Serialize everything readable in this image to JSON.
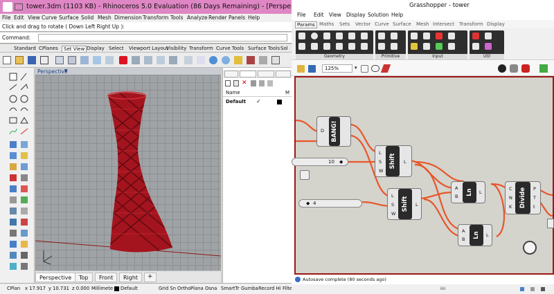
{
  "rhino": {
    "title": "tower.3dm (1103 KB) - Rhinoceros 5.0 Evaluation (86 Days Remaining) - [Perspective]",
    "menu": [
      "File",
      "Edit",
      "View",
      "Curve",
      "Surface",
      "Solid",
      "Mesh",
      "Dimension",
      "Transform",
      "Tools",
      "Analyze",
      "Render",
      "Panels",
      "Help"
    ],
    "command_history": "Click and drag to rotate ( Down  Left  Right  Up ):",
    "command_label": "Command:",
    "toolbar_tabs": [
      "Standard",
      "CPlanes",
      "Set View",
      "Display",
      "Select",
      "Viewport Layout",
      "Visibility",
      "Transform",
      "Curve Tools",
      "Surface Tools",
      "Sol"
    ],
    "viewport_label": "Perspective",
    "viewport_tabs": [
      "Perspective",
      "Top",
      "Front",
      "Right"
    ],
    "layers": {
      "col_name": "Name",
      "col_m": "M",
      "rows": [
        {
          "name": "Default",
          "check": "✓"
        }
      ]
    },
    "status": {
      "cplane": "CPlan",
      "x": "x 17.917",
      "y": "y 10.731",
      "z": "z 0.000",
      "units": "Millimete",
      "layer": "Default",
      "toggles": [
        "Grid Sn",
        "Ortho",
        "Plana",
        "Osna",
        "SmartTr",
        "Gumba",
        "Record Hi",
        "Filte"
      ]
    },
    "colors": {
      "accent": "#df86c4",
      "model": "#8f0f18"
    }
  },
  "grasshopper": {
    "title": "Grasshopper - tower",
    "menu": [
      "File",
      "Edit",
      "View",
      "Display",
      "Solution",
      "Help"
    ],
    "tabs": [
      "Params",
      "Maths",
      "Sets",
      "Vector",
      "Curve",
      "Surface",
      "Mesh",
      "Intersect",
      "Transform",
      "Display"
    ],
    "ribbon_groups": [
      "Geometry",
      "Primitive",
      "Input",
      "Util"
    ],
    "zoom": "125%",
    "components": {
      "bang": {
        "name": "BANG!",
        "in": [
          "D"
        ]
      },
      "shift1": {
        "name": "Shift",
        "in": [
          "L",
          "S",
          "W"
        ],
        "out": [
          "L"
        ]
      },
      "shift2": {
        "name": "Shift",
        "in": [
          "L",
          "S",
          "W"
        ],
        "out": [
          "L"
        ]
      },
      "ln1": {
        "name": "Ln",
        "in": [
          "A",
          "B"
        ],
        "out": [
          "L"
        ]
      },
      "ln2": {
        "name": "Ln",
        "in": [
          "A",
          "B"
        ],
        "out": [
          "L"
        ]
      },
      "divide": {
        "name": "Divide",
        "in": [
          "C",
          "N",
          "K"
        ],
        "out": [
          "P",
          "T",
          "t"
        ]
      }
    },
    "sliders": {
      "s1": "10",
      "s2": "4"
    },
    "status": "Autosave complete (80 seconds ago)",
    "taskbar_text": "ini",
    "colors": {
      "wire": "#e8562a",
      "frame": "#9b1717"
    }
  }
}
